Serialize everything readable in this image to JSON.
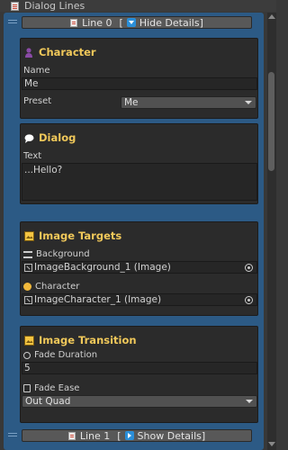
{
  "window": {
    "title": "Dialog Lines",
    "icon": "dialog-doc-icon"
  },
  "line0": {
    "label": "Line 0",
    "bracket_open": "[",
    "bracket_close": "]",
    "toggle_label": "Hide Details",
    "toggle_icon": "triangle-down-icon"
  },
  "line1": {
    "label": "Line 1",
    "bracket_open": "[",
    "bracket_close": "]",
    "toggle_label": "Show Details",
    "toggle_icon": "triangle-right-icon"
  },
  "character": {
    "title": "Character",
    "icon": "person-icon",
    "name_label": "Name",
    "name_value": "Me",
    "preset_label": "Preset",
    "preset_value": "Me"
  },
  "dialog": {
    "title": "Dialog",
    "icon": "speech-bubble-icon",
    "text_label": "Text",
    "text_value": "...Hello?"
  },
  "image_targets": {
    "title": "Image Targets",
    "icon": "image-frame-icon",
    "background_label": "Background",
    "background_icon": "film-strip-icon",
    "background_value": "ImageBackground_1 (Image)",
    "character_label": "Character",
    "character_icon": "face-icon",
    "character_value": "ImageCharacter_1 (Image)"
  },
  "image_transition": {
    "title": "Image Transition",
    "icon": "image-frame-icon",
    "duration_label": "Fade Duration",
    "duration_icon": "stopwatch-icon",
    "duration_value": "5",
    "ease_label": "Fade Ease",
    "ease_icon": "curve-icon",
    "ease_value": "Out Quad"
  },
  "colors": {
    "accent_blue": "#2c5a85",
    "title_gold": "#f0c85a",
    "panel": "#2b2b2b"
  }
}
